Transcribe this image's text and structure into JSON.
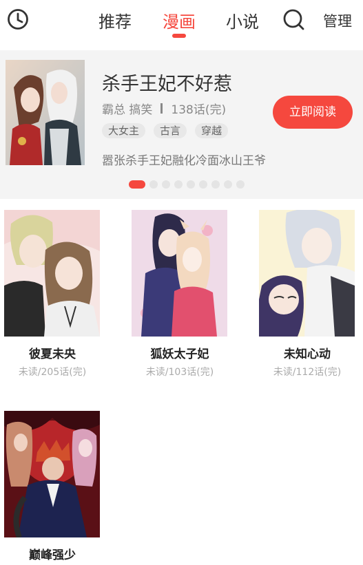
{
  "header": {
    "history_icon": "clock-icon",
    "tabs": [
      {
        "label": "推荐",
        "active": false
      },
      {
        "label": "漫画",
        "active": true
      },
      {
        "label": "小说",
        "active": false
      }
    ],
    "search_icon": "search-icon",
    "manage_label": "管理",
    "accent_color": "#f5483e"
  },
  "banner": {
    "title": "杀手王妃不好惹",
    "genre": "霸总 搞笑",
    "chapters": "138话(完)",
    "tags": [
      "大女主",
      "古言",
      "穿越"
    ],
    "description": "嚣张杀手王妃融化冷面冰山王爷",
    "read_button": "立即阅读",
    "page_count": 9,
    "current_page": 1
  },
  "books": [
    {
      "title": "彼夏未央",
      "status": "未读/205话(完)"
    },
    {
      "title": "狐妖太子妃",
      "status": "未读/103话(完)"
    },
    {
      "title": "未知心动",
      "status": "未读/112话(完)"
    },
    {
      "title": "巅峰强少",
      "status": ""
    }
  ]
}
